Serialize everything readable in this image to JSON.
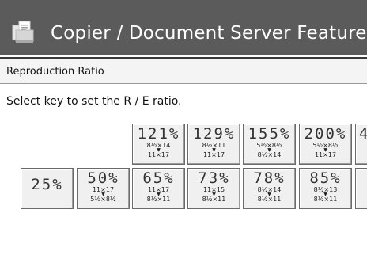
{
  "header": {
    "title": "Copier / Document Server Features",
    "icon": "copier-icon"
  },
  "panel": {
    "title": "Reproduction Ratio",
    "instruction": "Select key to set the R / E ratio."
  },
  "keys_top": [
    {
      "ratio": "121%",
      "from": "8½×14",
      "to": "11×17"
    },
    {
      "ratio": "129%",
      "from": "8½×11",
      "to": "11×17"
    },
    {
      "ratio": "155%",
      "from": "5½×8½",
      "to": "8½×14"
    },
    {
      "ratio": "200%",
      "from": "5½×8½",
      "to": "11×17"
    },
    {
      "ratio": "4",
      "from": "",
      "to": ""
    }
  ],
  "keys_bottom": [
    {
      "ratio": "25%",
      "from": "",
      "to": ""
    },
    {
      "ratio": "50%",
      "from": "11×17",
      "to": "5½×8½"
    },
    {
      "ratio": "65%",
      "from": "11×17",
      "to": "8½×11"
    },
    {
      "ratio": "73%",
      "from": "11×15",
      "to": "8½×11"
    },
    {
      "ratio": "78%",
      "from": "8½×14",
      "to": "8½×11"
    },
    {
      "ratio": "85%",
      "from": "8½×13",
      "to": "8½×11"
    },
    {
      "ratio": "",
      "from": "",
      "to": ""
    }
  ],
  "colors": {
    "titlebar": "#5b5b5b",
    "key_bg": "#f0f0f0"
  }
}
